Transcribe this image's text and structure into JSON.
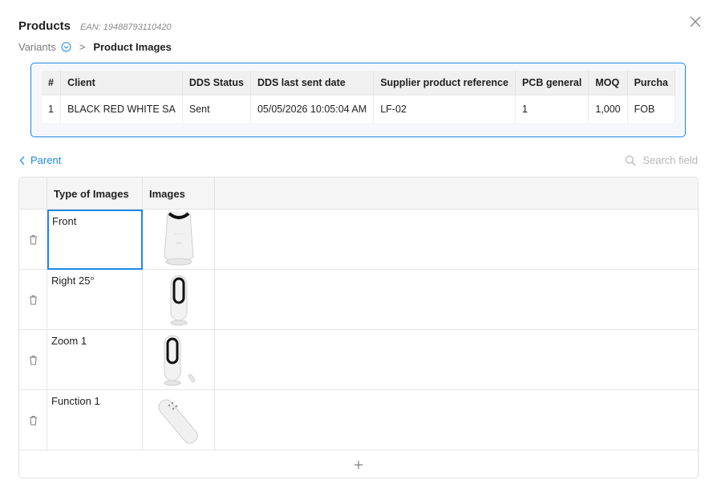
{
  "header": {
    "title": "Products",
    "ean": "EAN: 19488793110420"
  },
  "breadcrumb": {
    "parent": "Variants",
    "separator": ">",
    "current": "Product Images"
  },
  "parent_table": {
    "columns": [
      "#",
      "Client",
      "DDS Status",
      "DDS last sent date",
      "Supplier product reference",
      "PCB general",
      "MOQ",
      "Purcha"
    ],
    "row": [
      "1",
      "BLACK RED WHITE SA",
      "Sent",
      "05/05/2026 10:05:04 AM",
      "LF-02",
      "1",
      "1,000",
      "FOB"
    ]
  },
  "nav": {
    "parent_label": "Parent"
  },
  "search": {
    "placeholder": "Search field"
  },
  "grid": {
    "columns": [
      "Type of Images",
      "Images"
    ],
    "rows": [
      {
        "type": "Front",
        "image": "fan-front-icon"
      },
      {
        "type": "Right 25°",
        "image": "fan-side-icon"
      },
      {
        "type": "Zoom 1",
        "image": "fan-zoom-icon"
      },
      {
        "type": "Function 1",
        "image": "remote-icon"
      }
    ],
    "add_label": "+"
  },
  "colors": {
    "accent": "#1e88e5"
  }
}
